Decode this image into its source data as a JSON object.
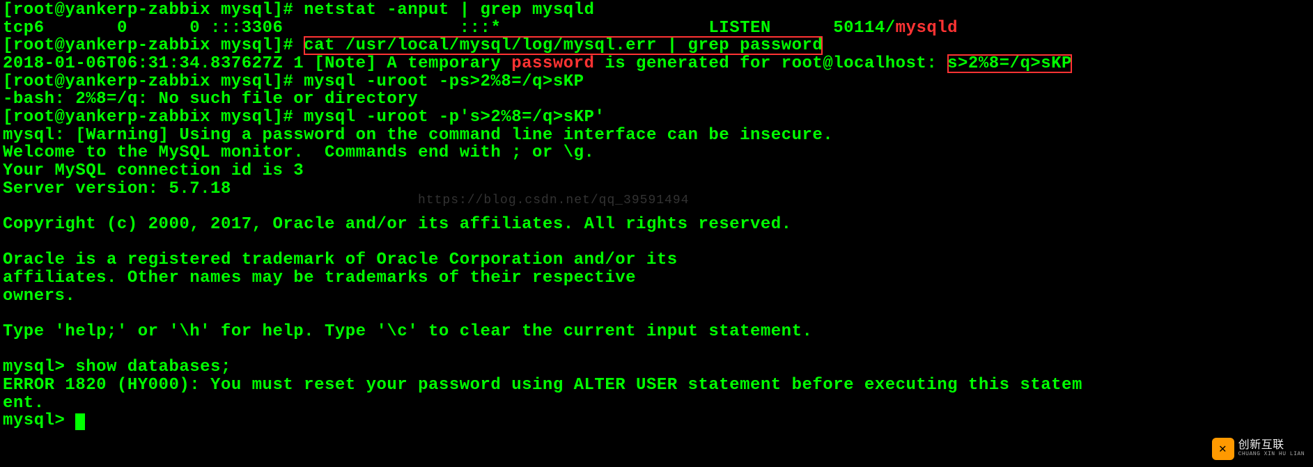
{
  "prompt_prefix": "[root@yankerp-zabbix mysql]# ",
  "cmd1": "netstat -anput | grep mysqld",
  "netstat": {
    "proto": "tcp6",
    "recvq": "0",
    "sendq": "0",
    "local": ":::3306",
    "foreign": ":::*",
    "state": "LISTEN",
    "pid": "50114/",
    "prog": "mysqld"
  },
  "cmd2": "cat /usr/local/mysql/log/mysql.err | grep password",
  "logl": {
    "ts": "2018-01-06T06:31:34.837627Z 1 [Note] A temporary ",
    "pw_word": "password",
    "mid": " is generated for root@localhost: ",
    "temp_pw": "s>2%8=/q>sKP"
  },
  "cmd3": "mysql -uroot -ps>2%8=/q>sKP",
  "bash_err": "-bash: 2%8=/q: No such file or directory",
  "cmd4": "mysql -uroot -p's>2%8=/q>sKP'",
  "mysql_warn": "mysql: [Warning] Using a password on the command line interface can be insecure.",
  "welcome1": "Welcome to the MySQL monitor.  Commands end with ; or \\g.",
  "welcome2": "Your MySQL connection id is 3",
  "welcome3": "Server version: 5.7.18",
  "copyright": "Copyright (c) 2000, 2017, Oracle and/or its affiliates. All rights reserved.",
  "oracle1": "Oracle is a registered trademark of Oracle Corporation and/or its",
  "oracle2": "affiliates. Other names may be trademarks of their respective",
  "oracle3": "owners.",
  "helpline": "Type 'help;' or '\\h' for help. Type '\\c' to clear the current input statement.",
  "mysql_prompt": "mysql> ",
  "mysql_cmd1": "show databases;",
  "err1": "ERROR 1820 (HY000): You must reset your password using ALTER USER statement before executing this statem\nent.",
  "watermark": "https://blog.csdn.net/qq_39591494",
  "logo_text_top": "创新互联",
  "logo_text_sub": "CHUANG XIN HU LIAN"
}
